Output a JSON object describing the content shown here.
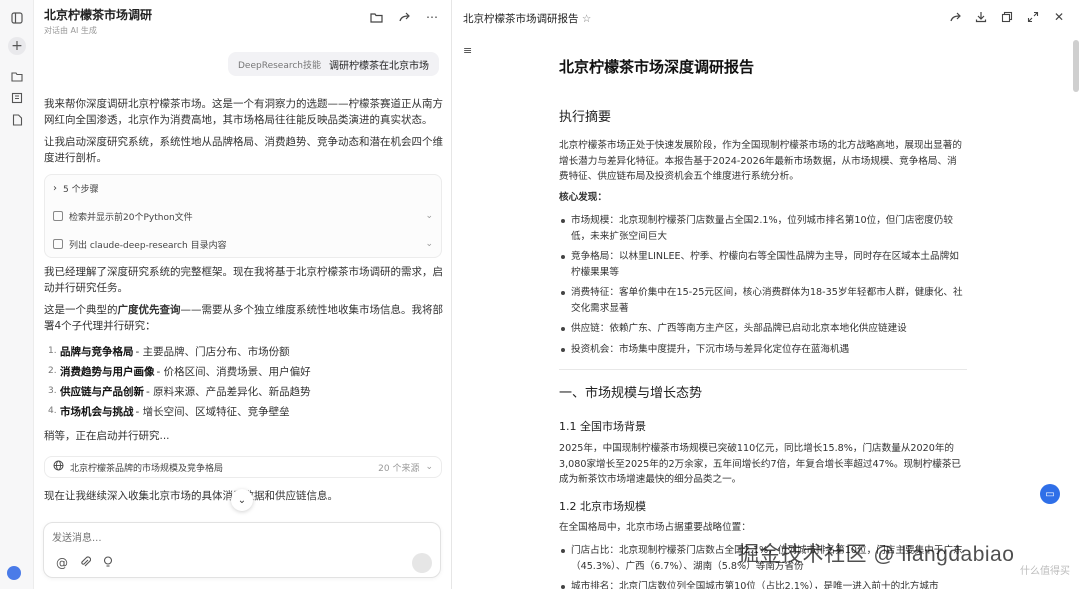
{
  "rail": {
    "icons": [
      "sidebar-toggle-icon",
      "new-chat-icon",
      "folder-icon",
      "library-icon",
      "document-icon",
      "user-avatar"
    ]
  },
  "chat": {
    "title": "北京柠檬茶市场调研",
    "subtitle": "对话由 AI 生成",
    "user_message": {
      "tag": "DeepResearch技能",
      "text": "调研柠檬茶在北京市场"
    },
    "paragraphs": [
      "我来帮你深度调研北京柠檬茶市场。这是一个有洞察力的选题——柠檬茶赛道正从南方网红向全国渗透，北京作为消费高地，其市场格局往往能反映品类演进的真实状态。",
      "让我启动深度研究系统，系统性地从品牌格局、消费趋势、竞争动态和潜在机会四个维度进行剖析。",
      "我已经理解了深度研究系统的完整框架。现在我将基于北京柠檬茶市场调研的需求，启动并行研究任务。",
      "这是一个典型的广度优先查询——需要从多个独立维度系统性地收集市场信息。我将部署4个子代理并行研究：",
      "稍等，正在启动并行研究...",
      "现在让我继续深入收集北京市场的具体消费数据和供应链信息。"
    ],
    "bold_term": "广度优先查询",
    "steps": {
      "header": "5 个步骤",
      "items": [
        "检索并显示前20个Python文件",
        "列出 claude-deep-research 目录内容"
      ]
    },
    "tasks": [
      {
        "num": "1.",
        "title": "品牌与竞争格局",
        "desc": " - 主要品牌、门店分布、市场份额"
      },
      {
        "num": "2.",
        "title": "消费趋势与用户画像",
        "desc": " - 价格区间、消费场景、用户偏好"
      },
      {
        "num": "3.",
        "title": "供应链与产品创新",
        "desc": " - 原料来源、产品差异化、新品趋势"
      },
      {
        "num": "4.",
        "title": "市场机会与挑战",
        "desc": " - 增长空间、区域特征、竞争壁垒"
      }
    ],
    "search": {
      "label": "北京柠檬茶品牌的市场规模及竞争格局",
      "sources": "20 个来源"
    },
    "composer_placeholder": "发送消息..."
  },
  "report": {
    "tab_title": "北京柠檬茶市场调研报告",
    "title": "北京柠檬茶市场深度调研报告",
    "exec_heading": "执行摘要",
    "exec_text": "北京柠檬茶市场正处于快速发展阶段，作为全国现制柠檬茶市场的北方战略高地，展现出显著的增长潜力与差异化特征。本报告基于2024-2026年最新市场数据，从市场规模、竞争格局、消费特征、供应链布局及投资机会五个维度进行系统分析。",
    "findings_label": "核心发现：",
    "findings": [
      "市场规模：北京现制柠檬茶门店数量占全国2.1%，位列城市排名第10位，但门店密度仍较低，未来扩张空间巨大",
      "竞争格局：以林里LINLEE、柠季、柠檬向右等全国性品牌为主导，同时存在区域本土品牌如柠檬果果等",
      "消费特征：客单价集中在15-25元区间，核心消费群体为18-35岁年轻都市人群，健康化、社交化需求显著",
      "供应链：依赖广东、广西等南方主产区，头部品牌已启动北京本地化供应链建设",
      "投资机会：市场集中度提升，下沉市场与差异化定位存在蓝海机遇"
    ],
    "section1": "一、市场规模与增长态势",
    "sub11": "1.1 全国市场背景",
    "text11": "2025年，中国现制柠檬茶市场规模已突破110亿元，同比增长15.8%，门店数量从2020年的3,080家增长至2025年的2万余家，五年间增长约7倍，年复合增长率超过47%。现制柠檬茶已成为新茶饮市场增速最快的细分品类之一。",
    "sub12": "1.2 北京市场规模",
    "text12": "在全国格局中，北京市场占据重要战略位置：",
    "bullets12": [
      "门店占比：北京现制柠檬茶门店数占全国2.1%，位列城市排名第10位，门店主要集中于广东（45.3%）、广西（6.7%）、湖南（5.8%）等南方省份",
      "城市排名：北京门店数位列全国城市第10位（占比2.1%），是唯一进入前十的北方城市"
    ]
  },
  "overlay": {
    "watermark": "掘金技术社区 @ liangdabiao",
    "watermark2": "什么值得买"
  }
}
